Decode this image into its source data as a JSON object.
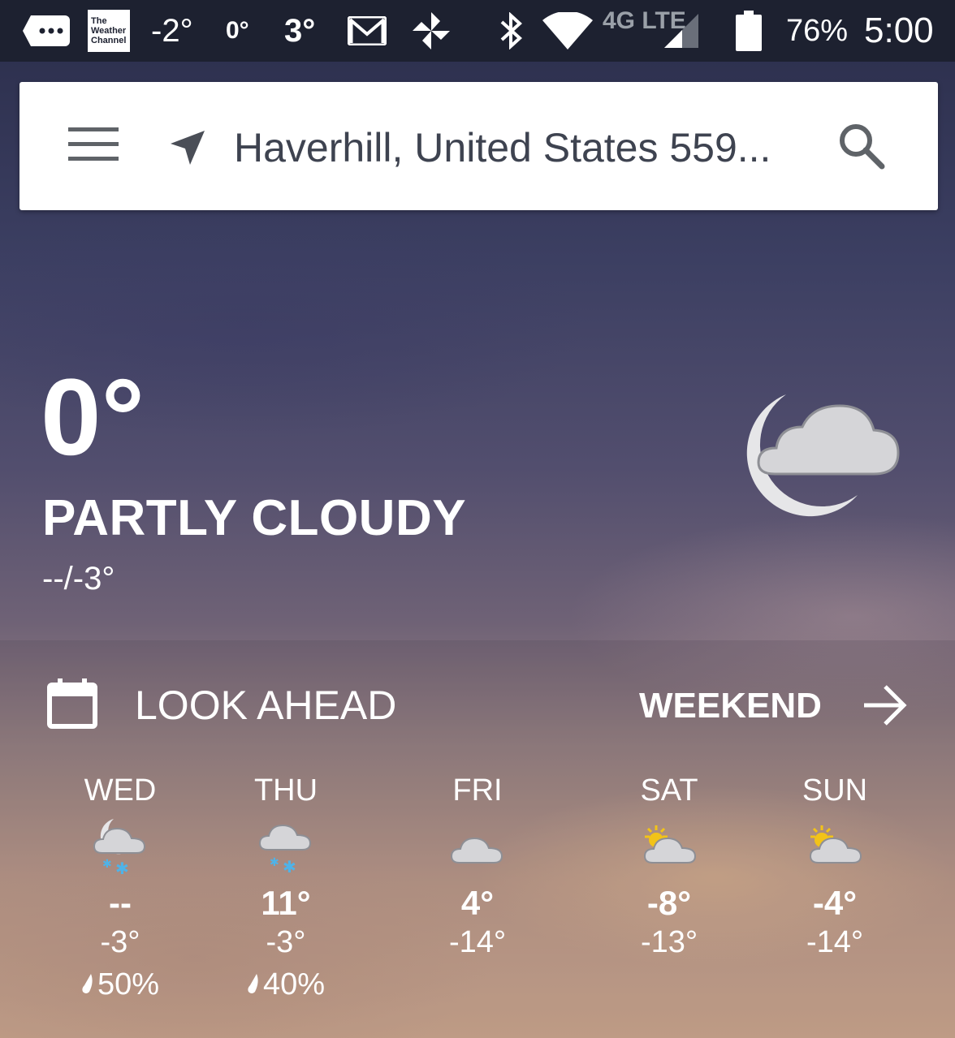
{
  "status_bar": {
    "app_logo_text": "The Weather Channel",
    "temps": [
      "-2°",
      "0°",
      "3°"
    ],
    "network": "4G LTE",
    "battery": "76%",
    "time": "5:00"
  },
  "search": {
    "location": "Haverhill, United States 559..."
  },
  "current": {
    "temperature": "0°",
    "condition": "PARTLY CLOUDY",
    "hi_lo": "--/-3°"
  },
  "look_ahead": {
    "title": "LOOK AHEAD",
    "weekend_label": "WEEKEND",
    "days": [
      {
        "name": "WED",
        "hi": "--",
        "lo": "-3°",
        "precip": "50%",
        "icon": "night-cloud-snow-icon"
      },
      {
        "name": "THU",
        "hi": "11°",
        "lo": "-3°",
        "precip": "40%",
        "icon": "cloud-snow-icon"
      },
      {
        "name": "FRI",
        "hi": "4°",
        "lo": "-14°",
        "precip": "",
        "icon": "cloud-icon"
      },
      {
        "name": "SAT",
        "hi": "-8°",
        "lo": "-13°",
        "precip": "",
        "icon": "sun-cloud-icon"
      },
      {
        "name": "SUN",
        "hi": "-4°",
        "lo": "-14°",
        "precip": "",
        "icon": "sun-cloud-icon"
      }
    ]
  },
  "colors": {
    "status_bar_bg": "#1d2130",
    "search_text": "#3e4350",
    "icon_gray": "#5f6368",
    "sun_yellow": "#f2c318",
    "snow_blue": "#4fb3e8"
  }
}
